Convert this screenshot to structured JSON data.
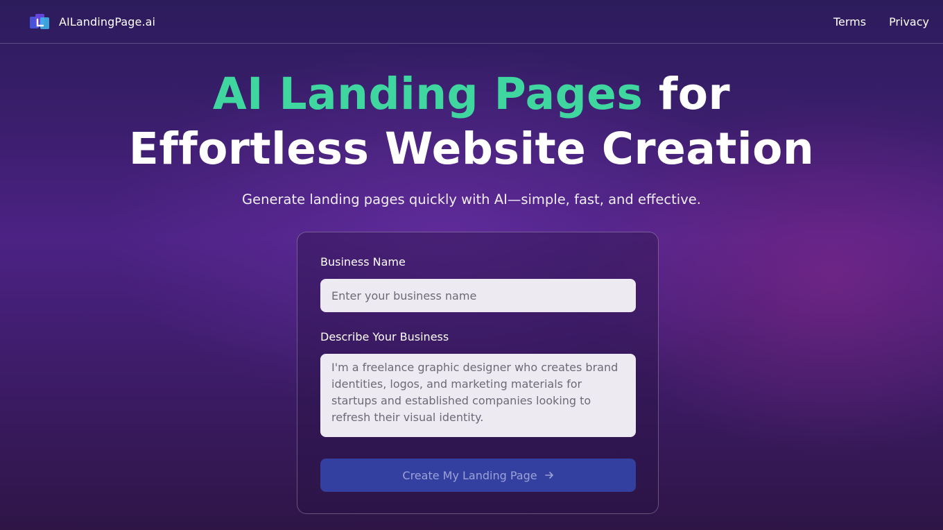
{
  "header": {
    "brand_name": "AILandingPage.ai",
    "logo_icon": "stacked-pages-logo-icon",
    "nav": [
      {
        "label": "Terms"
      },
      {
        "label": "Privacy"
      }
    ]
  },
  "hero": {
    "title_accent": "AI Landing Pages",
    "title_rest_line1": " for",
    "title_line2": "Effortless Website Creation",
    "subtitle": "Generate landing pages quickly with AI—simple, fast, and effective."
  },
  "form": {
    "business_name_label": "Business Name",
    "business_name_placeholder": "Enter your business name",
    "business_name_value": "",
    "description_label": "Describe Your Business",
    "description_placeholder": "I'm a freelance graphic designer who creates brand identities, logos, and marketing materials for startups and established companies looking to refresh their visual identity.",
    "description_value": "",
    "submit_label": "Create My Landing Page",
    "submit_icon": "arrow-right-icon"
  },
  "colors": {
    "accent": "#3fd6a0",
    "button": "#3340a0"
  }
}
